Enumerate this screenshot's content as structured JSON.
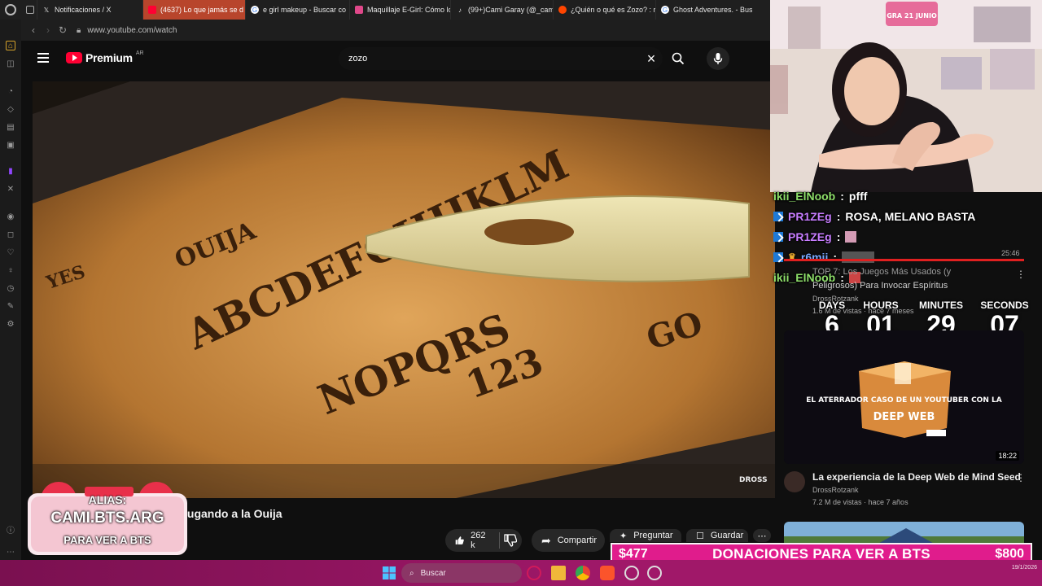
{
  "browser": {
    "tabs": [
      {
        "label": "Notificaciones / X",
        "icon": "x-icon"
      },
      {
        "label": "(4637) Lo que jamás se d",
        "icon": "youtube-icon",
        "active": true
      },
      {
        "label": "e girl makeup - Buscar co",
        "icon": "google-icon"
      },
      {
        "label": "Maquillaje E-Girl: Cómo lo",
        "icon": "site-icon"
      },
      {
        "label": "(99+)Cami Garay (@_cam",
        "icon": "tiktok-icon"
      },
      {
        "label": "¿Quién o qué es Zozo? : r",
        "icon": "reddit-icon"
      },
      {
        "label": "Ghost Adventures. - Busc",
        "icon": "google-icon"
      }
    ],
    "url": "www.youtube.com/watch"
  },
  "youtube": {
    "logo_text": "Premium",
    "country": "AR",
    "search_value": "zozo"
  },
  "video": {
    "title": "jugando a la Ouija",
    "likes": "262 k",
    "share_label": "Compartir",
    "ask_label": "Preguntar",
    "save_label": "Guardar",
    "watermark": "DROSS"
  },
  "chat": [
    {
      "user": "ikii_ElNoob",
      "message": "pfff",
      "color": "#8ee06a",
      "badge": false
    },
    {
      "user": "PR1ZEg",
      "message": "ROSA, MELANO BASTA",
      "color": "#c77dff",
      "badge": true
    },
    {
      "user": "PR1ZEg",
      "message": "",
      "color": "#c77dff",
      "badge": true,
      "emote": true
    },
    {
      "user": "r6mii",
      "message": "",
      "color": "#78a9ff",
      "badge": true,
      "emote": true
    },
    {
      "user": "ikii_ElNoob",
      "message": "",
      "color": "#8ee06a",
      "badge": false,
      "emote": true
    }
  ],
  "recommended": [
    {
      "title_line1": "TOP 7: Los Juegos Más Usados (y",
      "title_line2": "Peligrosos) Para Invocar Espíritus",
      "channel": "DrossRotzank",
      "meta": "1.6 M de vistas · hace 7 meses",
      "duration": "25:46"
    },
    {
      "title": "La experiencia de la Deep Web de Mind Seed",
      "channel": "DrossRotzank",
      "meta": "7.2 M de vistas · hace 7 años",
      "duration": "18:22",
      "thumb_line1": "EL ATERRADOR CASO DE UN YOUTUBER CON LA",
      "thumb_line2": "DEEP WEB"
    }
  ],
  "countdown": {
    "days_label": "DAYS",
    "days": "6",
    "hours_label": "HOURS",
    "hours": "01",
    "minutes_label": "MINUTES",
    "minutes": "29",
    "seconds_label": "SECONDS",
    "seconds": "07"
  },
  "donations": {
    "current": "$477",
    "message": "DONACIONES PARA VER A BTS",
    "goal": "$800"
  },
  "alias_badge": {
    "line1": "ALIAS:",
    "line2": "CAMI.BTS.ARG",
    "line3": "PARA VER A BTS"
  },
  "webcam_sign": "GRA 21 JUNIO",
  "taskbar": {
    "search_label": "Buscar",
    "clock_date": "19/1/2026"
  },
  "colors": {
    "youtube_red": "#ff0033",
    "donation_pink": "#e01c8c",
    "taskbar": "#a01869"
  }
}
